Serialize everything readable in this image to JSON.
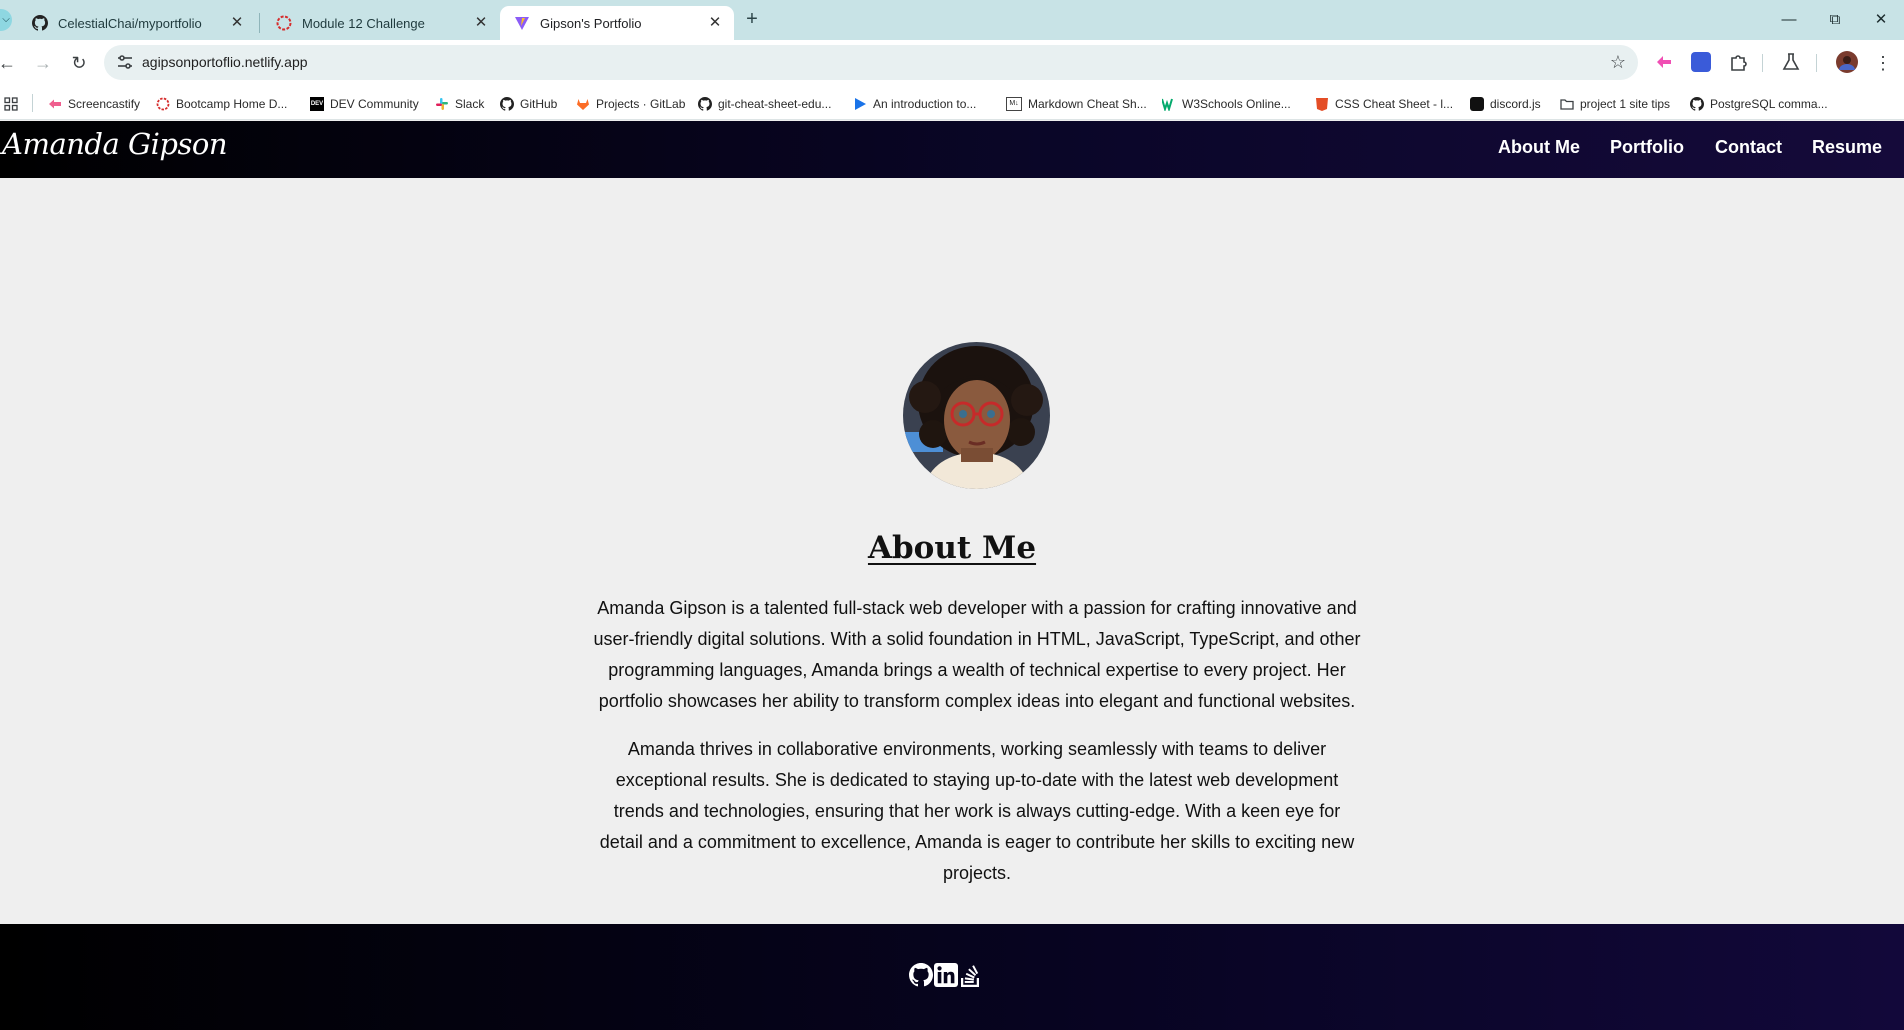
{
  "browser": {
    "tabs": [
      {
        "title": "CelestialChai/myportfolio",
        "icon": "github-icon"
      },
      {
        "title": "Module 12 Challenge",
        "icon": "bootcamp-icon"
      },
      {
        "title": "Gipson's Portfolio",
        "icon": "vite-icon"
      }
    ],
    "address": "agipsonportoflio.netlify.app",
    "bookmarks": [
      "Screencastify",
      "Bootcamp Home D...",
      "DEV Community",
      "Slack",
      "GitHub",
      "Projects · GitLab",
      "git-cheat-sheet-edu...",
      "An introduction to...",
      "Markdown Cheat Sh...",
      "W3Schools Online...",
      "CSS Cheat Sheet - l...",
      "discord.js",
      "project 1 site tips",
      "PostgreSQL comma..."
    ],
    "dev_icon_text": "DEV",
    "md_icon_text": "M↓"
  },
  "site": {
    "brand": "Amanda Gipson",
    "nav": [
      "About Me",
      "Portfolio",
      "Contact",
      "Resume"
    ],
    "about_title": "About Me",
    "paragraphs": [
      "Amanda Gipson is a talented full-stack web developer with a passion for crafting innovative and user-friendly digital solutions. With a solid foundation in HTML, JavaScript, TypeScript, and other programming languages, Amanda brings a wealth of technical expertise to every project. Her portfolio showcases her ability to transform complex ideas into elegant and functional websites.",
      "Amanda thrives in collaborative environments, working seamlessly with teams to deliver exceptional results. She is dedicated to staying up-to-date with the latest web development trends and technologies, ensuring that her work is always cutting-edge. With a keen eye for detail and a commitment to excellence, Amanda is eager to contribute her skills to exciting new projects."
    ],
    "footer_icons": [
      "github-icon",
      "linkedin-icon",
      "stackoverflow-icon"
    ]
  },
  "colors": {
    "tabbar": "#c8e3e6",
    "header_dark": "#0a0628",
    "page_bg": "#efefef"
  }
}
